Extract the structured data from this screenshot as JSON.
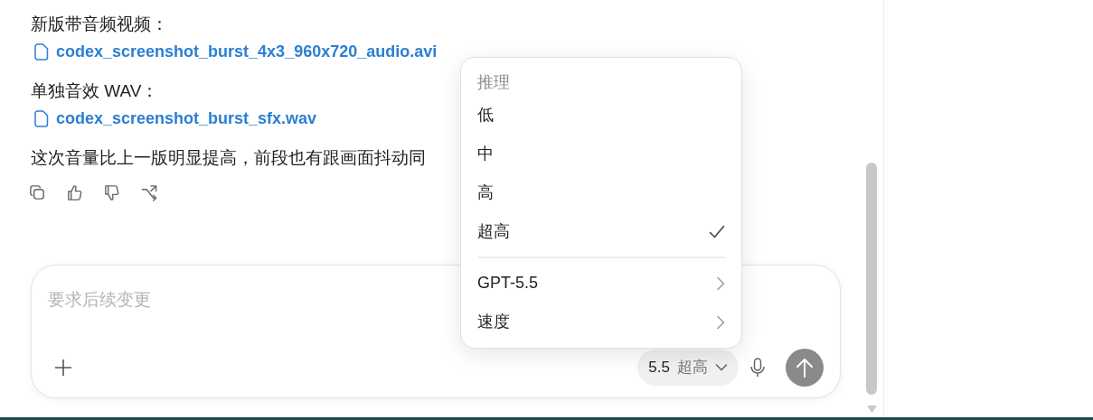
{
  "message": {
    "blocks": [
      {
        "kind": "label",
        "text": "新版带音频视频："
      },
      {
        "kind": "file",
        "text": "codex_screenshot_burst_4x3_960x720_audio.avi"
      },
      {
        "kind": "label",
        "text": "单独音效 WAV："
      },
      {
        "kind": "file",
        "text": "codex_screenshot_burst_sfx.wav"
      },
      {
        "kind": "paragraph",
        "text": "这次音量比上一版明显提高，前段也有跟画面抖动同"
      }
    ]
  },
  "menu": {
    "header": "推理",
    "items": [
      {
        "kind": "option",
        "label": "低",
        "selected": false
      },
      {
        "kind": "option",
        "label": "中",
        "selected": false
      },
      {
        "kind": "option",
        "label": "高",
        "selected": false
      },
      {
        "kind": "option",
        "label": "超高",
        "selected": true
      },
      {
        "kind": "submenu",
        "label": "GPT-5.5"
      },
      {
        "kind": "submenu",
        "label": "速度"
      }
    ]
  },
  "composer": {
    "placeholder": "要求后续变更",
    "model": "5.5",
    "effort": "超高"
  }
}
